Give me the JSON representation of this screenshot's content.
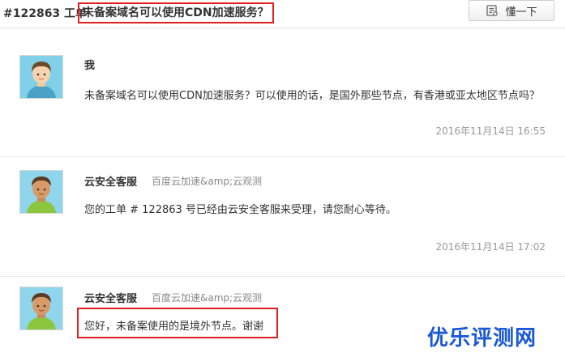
{
  "header": {
    "ticket_id": "#122863 工单",
    "subject": "未备案域名可以使用CDN加速服务？",
    "help_button_label": "懂一下"
  },
  "messages": [
    {
      "author": "我",
      "role": "",
      "content": "未备案域名可以使用CDN加速服务？可以使用的话，是国外那些节点，有香港或亚太地区节点吗？",
      "timestamp": "2016年11月14日 16:55"
    },
    {
      "author": "云安全客服",
      "role": "百度云加速&amp;云观测",
      "content": "您的工单 # 122863 号已经由云安全客服来受理，请您耐心等待。",
      "timestamp": "2016年11月14日 17:02"
    },
    {
      "author": "云安全客服",
      "role": "百度云加速&amp;云观测",
      "content": "您好，未备案使用的是境外节点。谢谢",
      "timestamp": ""
    }
  ],
  "watermark": "优乐评测网",
  "colors": {
    "highlight_border": "#e02020",
    "avatar_bg": "#7fd0e8",
    "watermark": "#1a58d6"
  },
  "icons": {
    "help": "help-doc-icon",
    "avatar": "user-avatar-icon"
  }
}
